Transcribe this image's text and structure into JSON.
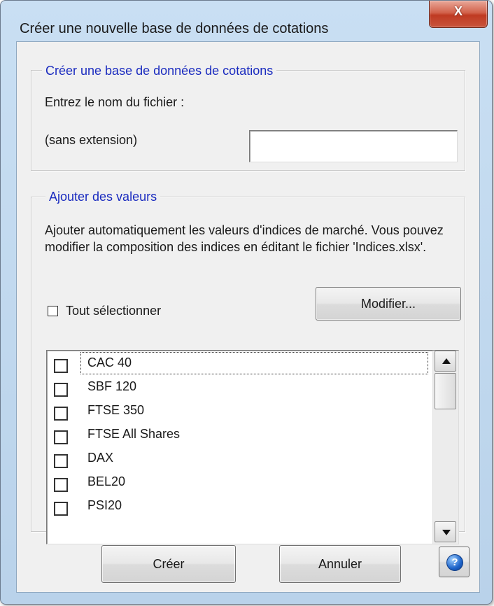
{
  "window": {
    "title": "Créer une nouvelle base de données de cotations",
    "close_label": "X"
  },
  "group_create": {
    "legend": "Créer une base de données de cotations",
    "filename_label": "Entrez le nom du fichier :",
    "extension_label": "(sans extension)",
    "filename_value": ""
  },
  "group_add": {
    "legend": "Ajouter des valeurs",
    "description": "Ajouter automatiquement les valeurs d'indices de marché. Vous pouvez modifier la composition des indices en éditant le fichier 'Indices.xlsx'.",
    "select_all_label": "Tout sélectionner",
    "select_all_checked": false,
    "modify_button": "Modifier...",
    "indices": [
      {
        "label": "CAC 40",
        "checked": false
      },
      {
        "label": "SBF 120",
        "checked": false
      },
      {
        "label": "FTSE 350",
        "checked": false
      },
      {
        "label": "FTSE All Shares",
        "checked": false
      },
      {
        "label": "DAX",
        "checked": false
      },
      {
        "label": "BEL20",
        "checked": false
      },
      {
        "label": "PSI20",
        "checked": false
      }
    ]
  },
  "footer": {
    "create_button": "Créer",
    "cancel_button": "Annuler",
    "help_icon": "help-icon",
    "help_glyph": "?"
  },
  "colors": {
    "legend_text": "#1a2bbf",
    "titlebar": "#c9dff3",
    "close_button": "#c9553d",
    "dialog_body": "#f0f0f0"
  }
}
